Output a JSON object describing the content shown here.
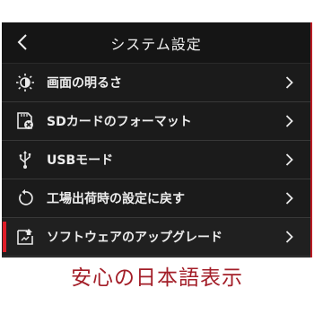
{
  "header": {
    "title": "システム設定",
    "back_icon": "chevron-left-icon"
  },
  "menu": {
    "items": [
      {
        "label": "画面の明るさ",
        "icon": "brightness-icon"
      },
      {
        "label": "SDカードのフォーマット",
        "icon": "sd-card-format-icon"
      },
      {
        "label": "USBモード",
        "icon": "usb-icon"
      },
      {
        "label": "工場出荷時の設定に戻す",
        "icon": "reset-icon"
      },
      {
        "label": "ソフトウェアのアップグレード",
        "icon": "software-upgrade-icon",
        "selected": true
      }
    ],
    "chevron_icon": "chevron-right-icon"
  },
  "caption": "安心の日本語表示",
  "colors": {
    "accent": "#e01d28",
    "caption": "#a31e28",
    "panel": "#1b1b1b",
    "text": "#ededed"
  }
}
